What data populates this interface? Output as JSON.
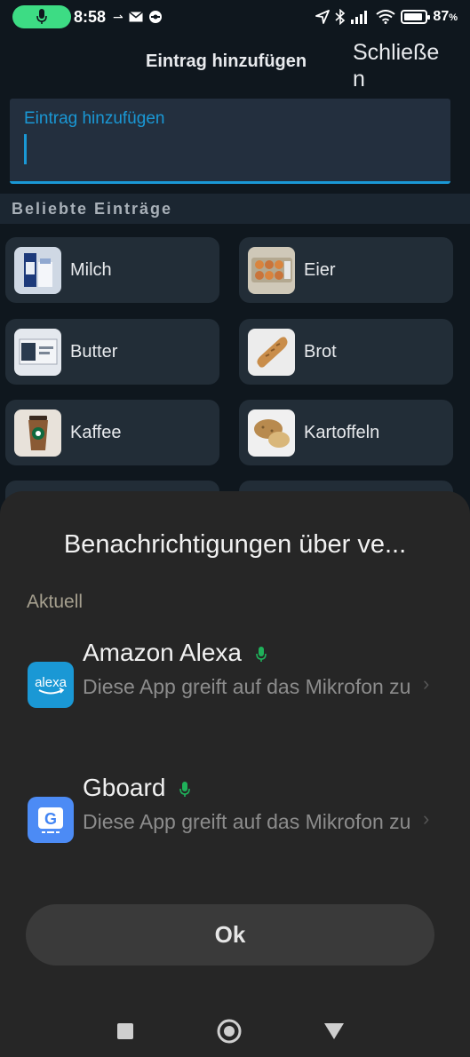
{
  "status_bar": {
    "time": "8:58",
    "battery_pct": "87",
    "battery_unit": "%",
    "battery_level": 0.87,
    "mic_color": "#3ddc84"
  },
  "header": {
    "title": "Eintrag hinzufügen",
    "close_label": "Schließen"
  },
  "entry_input": {
    "label": "Eintrag hinzufügen",
    "value": ""
  },
  "popular": {
    "heading": "Beliebte Einträge",
    "items": [
      {
        "label": "Milch",
        "icon": "milk-icon"
      },
      {
        "label": "Eier",
        "icon": "eggs-icon"
      },
      {
        "label": "Butter",
        "icon": "butter-icon"
      },
      {
        "label": "Brot",
        "icon": "bread-icon"
      },
      {
        "label": "Kaffee",
        "icon": "coffee-icon"
      },
      {
        "label": "Kartoffeln",
        "icon": "potato-icon"
      }
    ]
  },
  "sheet": {
    "title": "Benachrichtigungen über ve...",
    "section": "Aktuell",
    "apps": [
      {
        "name": "Amazon Alexa",
        "icon_text": "alexa",
        "description": "Diese App greift auf das Mikrofon zu",
        "icon_color": "#1a98d5"
      },
      {
        "name": "Gboard",
        "icon_text": "G",
        "description": "Diese App greift auf das Mikrofon zu",
        "icon_color": "#4c8bf5"
      }
    ],
    "ok_label": "Ok",
    "accent_color": "#1fb15a"
  }
}
